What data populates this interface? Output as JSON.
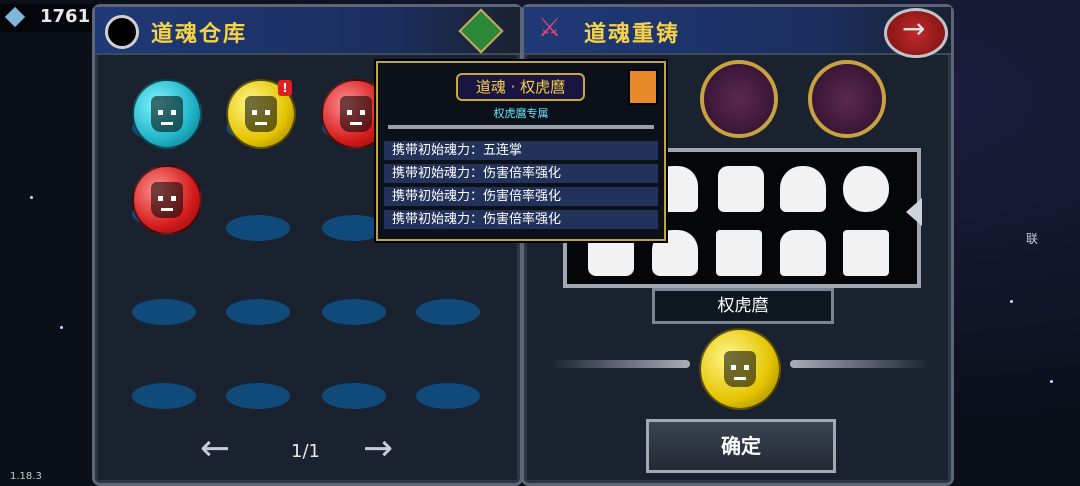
{
  "currency": {
    "gems": "1761",
    "icon": "diamond-icon"
  },
  "version": "1.18.3",
  "left_panel": {
    "title": "道魂仓库",
    "pager": "1/1",
    "orbs": [
      {
        "color": "#1fb3c8",
        "badge": ""
      },
      {
        "color": "#e4c400",
        "badge": "!"
      },
      {
        "color": "#d41c1c",
        "badge": ""
      },
      {
        "color": "#d41c1c",
        "badge": ""
      }
    ]
  },
  "right_panel": {
    "title": "道魂重铸",
    "selected_name": "权虎麿",
    "confirm_label": "确定"
  },
  "tooltip": {
    "title": "道魂 · 权虎麿",
    "subtitle": "权虎麿专属",
    "rows": [
      "携带初始魂力：五连掌",
      "携带初始魂力：伤害倍率强化",
      "携带初始魂力：伤害倍率强化",
      "携带初始魂力：伤害倍率强化"
    ]
  },
  "side_label": "联"
}
